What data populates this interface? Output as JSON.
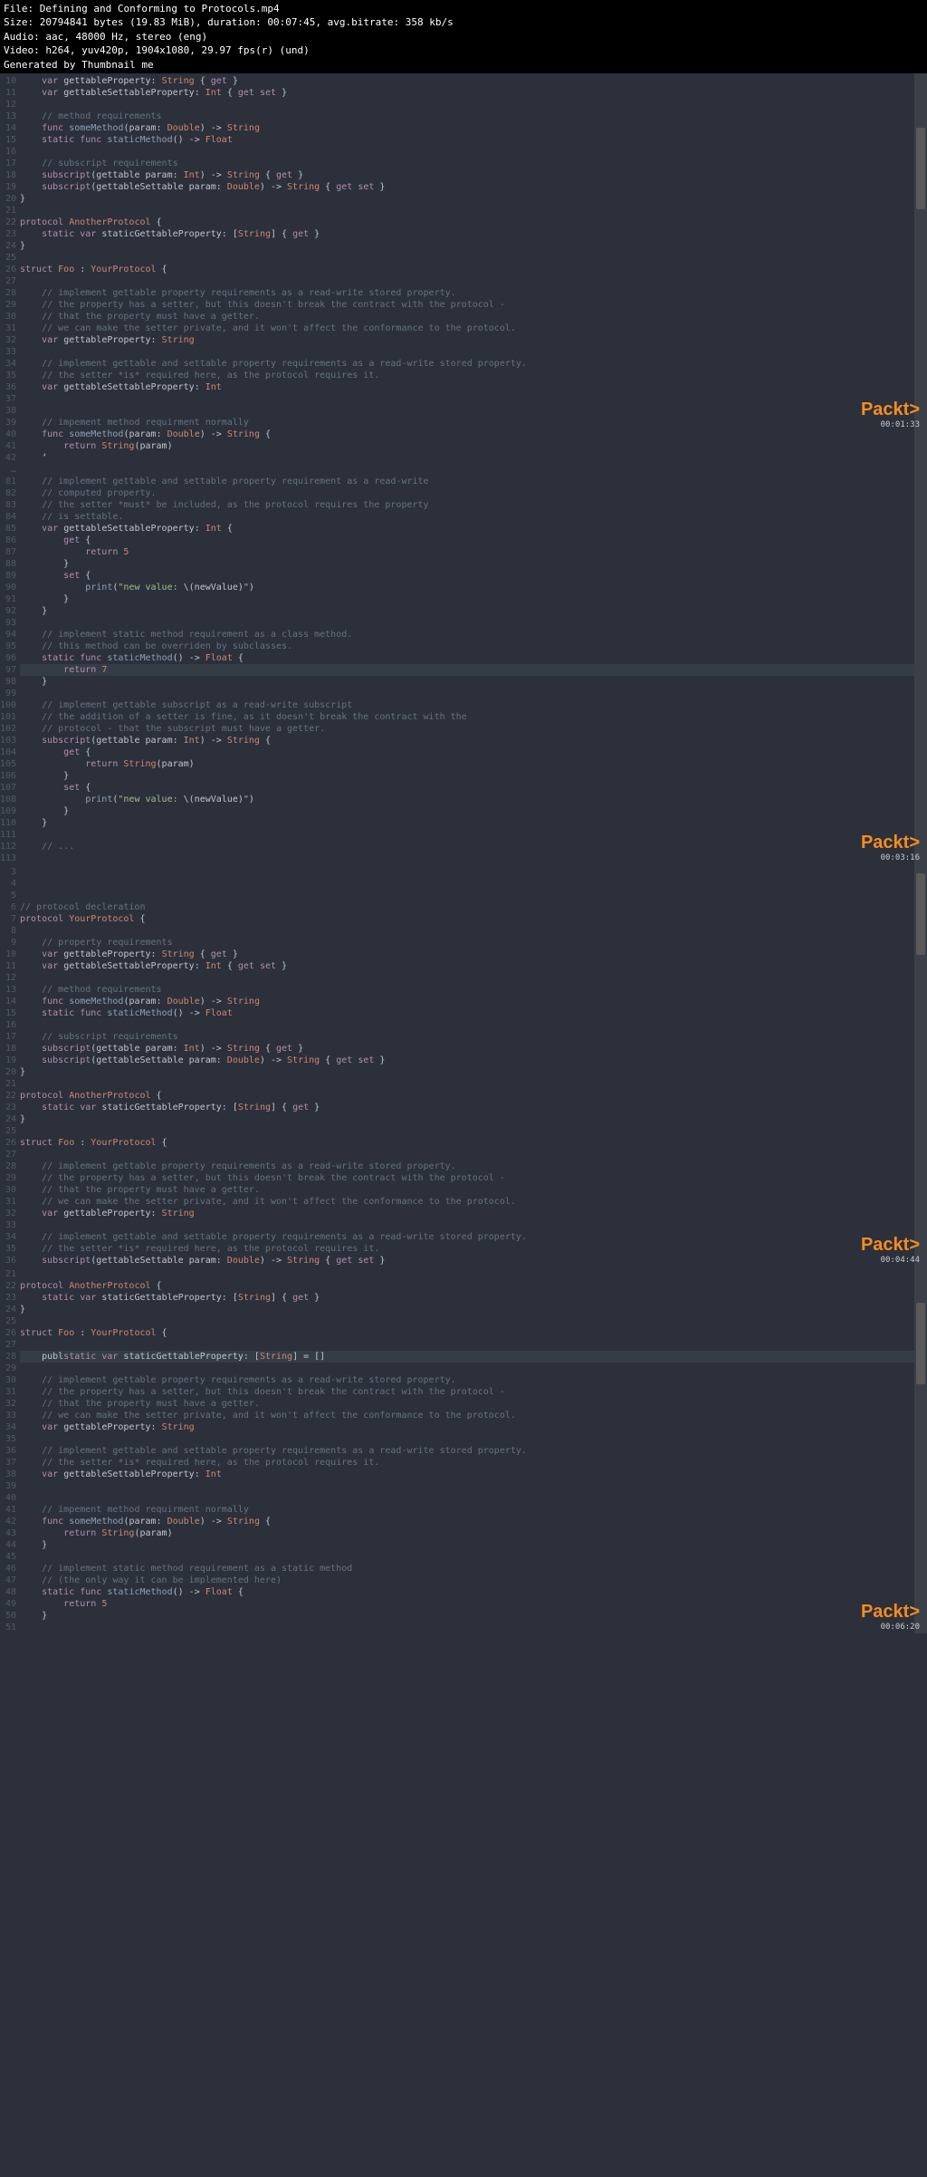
{
  "header": {
    "l1": "File: Defining and Conforming to Protocols.mp4",
    "l2": "Size: 20794841 bytes (19.83 MiB), duration: 00:07:45, avg.bitrate: 358 kb/s",
    "l3": "Audio: aac, 48000 Hz, stereo (eng)",
    "l4": "Video: h264, yuv420p, 1904x1080, 29.97 fps(r) (und)",
    "l5": "Generated by Thumbnail me"
  },
  "wm": {
    "brand": "Packt",
    "gt": ">",
    "ts1": "00:01:33",
    "ts2": "00:03:16",
    "ts3": "00:04:44",
    "ts4": "00:06:20"
  },
  "panes": {
    "p1": {
      "gut": [
        "10",
        "11",
        "12",
        "13",
        "14",
        "15",
        "16",
        "17",
        "18",
        "19",
        "20",
        "21",
        "22",
        "23",
        "24",
        "25",
        "26",
        "27",
        "28",
        "29",
        "30",
        "31",
        "32",
        "33",
        "34",
        "35",
        "36",
        "37",
        "38",
        "39",
        "40",
        "41",
        "42",
        "…",
        "81",
        "82",
        "83",
        "84",
        "85",
        "86",
        "87",
        "88",
        "89",
        "90",
        "91",
        "92",
        "93",
        "94",
        "95",
        "96",
        "97",
        "98",
        "99",
        "100",
        "101",
        "102",
        "103",
        "104",
        "105",
        "106",
        "107",
        "108",
        "109",
        "110",
        "111",
        "112",
        "113"
      ],
      "lines": [
        "    <kw>var</kw> <id>gettableProperty</id>: <typ>String</typ> { <kw>get</kw> }",
        "    <kw>var</kw> <id>gettableSettableProperty</id>: <typ>Int</typ> { <kw>get</kw> <kw>set</kw> }",
        "",
        "    <cm>// method requirements</cm>",
        "    <kw>func</kw> <fn>someMethod</fn>(param: <typ>Double</typ>) -> <typ>String</typ>",
        "    <kw>static</kw> <kw>func</kw> <fn>staticMethod</fn>() -> <typ>Float</typ>",
        "",
        "    <cm>// subscript requirements</cm>",
        "    <kw>subscript</kw>(gettable param: <typ>Int</typ>) -> <typ>String</typ> { <kw>get</kw> }",
        "    <kw>subscript</kw>(gettableSettable param: <typ>Double</typ>) -> <typ>String</typ> { <kw>get</kw> <kw>set</kw> }",
        "}",
        "",
        "<kw>protocol</kw> <typ>AnotherProtocol</typ> {",
        "    <kw>static</kw> <kw>var</kw> <id>staticGettableProperty</id>: [<typ>String</typ>] { <kw>get</kw> }",
        "}",
        "",
        "<kw>struct</kw> <typ>Foo</typ> : <typ>YourProtocol</typ> {",
        "",
        "    <cm>// implement gettable property requirements as a read-write stored property.</cm>",
        "    <cm>// the property has a setter, but this doesn't break the contract with the protocol -</cm>",
        "    <cm>// that the property must have a getter.</cm>",
        "    <cm>// we can make the setter private, and it won't affect the conformance to the protocol.</cm>",
        "    <kw>var</kw> <id>gettableProperty</id>: <typ>String</typ>",
        "",
        "    <cm>// implement gettable and settable property requirements as a read-write stored property.</cm>",
        "    <cm>// the setter *is* required here, as the protocol requires it.</cm>",
        "    <kw>var</kw> <id>gettableSettableProperty</id>: <typ>Int</typ>",
        "",
        "",
        "    <cm>// impement method requirment normally</cm>",
        "    <kw>func</kw> <fn>someMethod</fn>(param: <typ>Double</typ>) -> <typ>String</typ> {",
        "        <kw>return</kw> <typ>String</typ>(param)",
        "    ‘",
        "",
        "    <cm>// implement gettable and settable property requirement as a read-write</cm>",
        "    <cm>// computed property.</cm>",
        "    <cm>// the setter *must* be included, as the protocol requires the property</cm>",
        "    <cm>// is settable.</cm>",
        "    <kw>var</kw> <id>gettableSettableProperty</id>: <typ>Int</typ> {",
        "        <kw>get</kw> {",
        "            <kw>return</kw> <num>5</num>",
        "        }",
        "        <kw>set</kw> {",
        "            <fn>print</fn>(<str>\"new value: </str>\\(newValue)<str>\"</str>)",
        "        }",
        "    }",
        "",
        "    <cm>// implement static method requirement as a class method.</cm>",
        "    <cm>// this method can be overriden by subclasses.</cm>",
        "    <kw>static</kw> <kw>func</kw> <fn>staticMethod</fn>() -> <typ>Float</typ> {",
        "        <kw>return</kw> <num>7</num>",
        "    }",
        "",
        "    <cm>// implement gettable subscript as a read-write subscript</cm>",
        "    <cm>// the addition of a setter is fine, as it doesn't break the contract with the</cm>",
        "    <cm>// protocol - that the subscript must have a getter.</cm>",
        "    <kw>subscript</kw>(gettable param: <typ>Int</typ>) -> <typ>String</typ> {",
        "        <kw>get</kw> {",
        "            <kw>return</kw> <typ>String</typ>(param)",
        "        }",
        "        <kw>set</kw> {",
        "            <fn>print</fn>(<str>\"new value: </str>\\(newValue)<str>\"</str>)",
        "        }",
        "    }",
        "",
        "    <cm>// ...</cm>"
      ]
    },
    "p2": {
      "gut": [
        "3",
        "4",
        "5",
        "6",
        "7",
        "8",
        "9",
        "10",
        "11",
        "12",
        "13",
        "14",
        "15",
        "16",
        "17",
        "18",
        "19",
        "20",
        "21",
        "22",
        "23",
        "24",
        "25",
        "26",
        "27",
        "28",
        "29",
        "30",
        "31",
        "32",
        "33",
        "34",
        "35",
        "36"
      ],
      "lines": [
        "",
        "",
        "",
        "<cm>// protocol decleration</cm>",
        "<kw>protocol</kw> <typ>YourProtocol</typ> {",
        "",
        "    <cm>// property requirements</cm>",
        "    <kw>var</kw> <id>gettableProperty</id>: <typ>String</typ> { <kw>get</kw> }",
        "    <kw>var</kw> <id>gettableSettableProperty</id>: <typ>Int</typ> { <kw>get</kw> <kw>set</kw> }",
        "",
        "    <cm>// method requirements</cm>",
        "    <kw>func</kw> <fn>someMethod</fn>(param: <typ>Double</typ>) -> <typ>String</typ>",
        "    <kw>static</kw> <kw>func</kw> <fn>staticMethod</fn>() -> <typ>Float</typ>",
        "",
        "    <cm>// subscript requirements</cm>",
        "    <kw>subscript</kw>(gettable param: <typ>Int</typ>) -> <typ>String</typ> { <kw>get</kw> }",
        "    <kw>subscript</kw>(gettableSettable param: <typ>Double</typ>) -> <typ>String</typ> { <kw>get</kw> <kw>set</kw> }",
        "}",
        "",
        "<kw>protocol</kw> <typ>AnotherProtocol</typ> {",
        "    <kw>static</kw> <kw>var</kw> <id>staticGettableProperty</id>: [<typ>String</typ>] { <kw>get</kw> }",
        "}",
        "",
        "<kw>struct</kw> <typ>Foo</typ> : <typ>YourProtocol</typ> {",
        "",
        "    <cm>// implement gettable property requirements as a read-write stored property.</cm>",
        "    <cm>// the property has a setter, but this doesn't break the contract with the protocol -</cm>",
        "    <cm>// that the property must have a getter.</cm>",
        "    <cm>// we can make the setter private, and it won't affect the conformance to the protocol.</cm>",
        "    <kw>var</kw> <id>gettableProperty</id>: <typ>String</typ>",
        "",
        "    <cm>// implement gettable and settable property requirements as a read-write stored property.</cm>",
        "    <cm>// the setter *is* required here, as the protocol requires it.</cm>",
        "    <kw>subscript</kw>(gettableSettable param: <typ>Double</typ>) -> <typ>String</typ> { <kw>get</kw> <kw>set</kw> }"
      ]
    },
    "p3": {
      "gut": [
        "21",
        "22",
        "23",
        "24",
        "25",
        "26",
        "27",
        "28",
        "29",
        "30",
        "31",
        "32",
        "33",
        "34",
        "35",
        "36",
        "37",
        "38",
        "39",
        "40",
        "41",
        "42",
        "43",
        "44",
        "45",
        "46",
        "47",
        "48",
        "49",
        "50",
        "51"
      ],
      "lines": [
        "",
        "<kw>protocol</kw> <typ>AnotherProtocol</typ> {",
        "    <kw>static</kw> <kw>var</kw> <id>staticGettableProperty</id>: [<typ>String</typ>] { <kw>get</kw> }",
        "}",
        "",
        "<kw>struct</kw> <typ>Foo</typ> : <typ>YourProtocol</typ> {",
        "",
        "    publ<kw>static</kw> <kw>var</kw> <id>staticGettableProperty</id>: [<typ>String</typ>] = []",
        "",
        "    <cm>// implement gettable property requirements as a read-write stored property.</cm>",
        "    <cm>// the property has a setter, but this doesn't break the contract with the protocol -</cm>",
        "    <cm>// that the property must have a getter.</cm>",
        "    <cm>// we can make the setter private, and it won't affect the conformance to the protocol.</cm>",
        "    <kw>var</kw> <id>gettableProperty</id>: <typ>String</typ>",
        "",
        "    <cm>// implement gettable and settable property requirements as a read-write stored property.</cm>",
        "    <cm>// the setter *is* required here, as the protocol requires it.</cm>",
        "    <kw>var</kw> <id>gettableSettableProperty</id>: <typ>Int</typ>",
        "",
        "",
        "    <cm>// impement method requirment normally</cm>",
        "    <kw>func</kw> <fn>someMethod</fn>(param: <typ>Double</typ>) -> <typ>String</typ> {",
        "        <kw>return</kw> <typ>String</typ>(param)",
        "    }",
        "",
        "    <cm>// implement static method requirement as a static method</cm>",
        "    <cm>// (the only way it can be implemented here)</cm>",
        "    <kw>static</kw> <kw>func</kw> <fn>staticMethod</fn>() -> <typ>Float</typ> {",
        "        <kw>return</kw> <num>5</num>",
        "    }",
        ""
      ]
    }
  }
}
